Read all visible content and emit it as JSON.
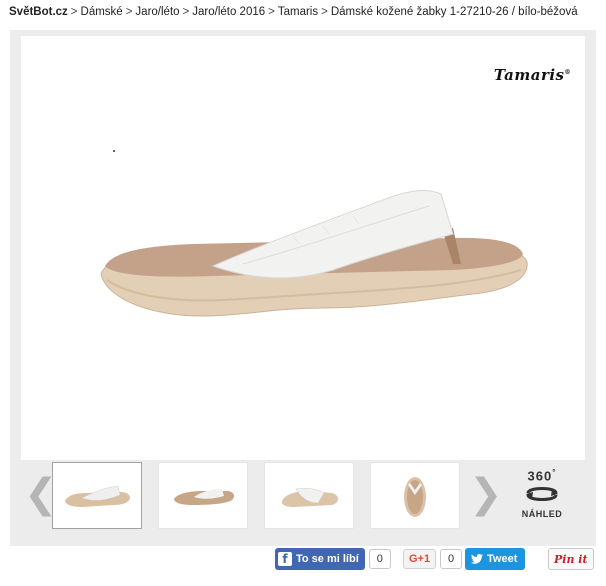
{
  "breadcrumb": {
    "items": [
      {
        "label": "SvětBot.cz"
      },
      {
        "label": "Dámské"
      },
      {
        "label": "Jaro/léto"
      },
      {
        "label": "Jaro/léto 2016"
      },
      {
        "label": "Tamaris"
      },
      {
        "label": "Dámské kožené žabky 1-27210-26 / bílo-béžová"
      }
    ],
    "separator": ">"
  },
  "gallery": {
    "brand_logo": "Tamaris",
    "brand_mark": "®",
    "prev_arrow": "❮",
    "next_arrow": "❯",
    "thumbnails": [
      {
        "icon": "sandal-side-view",
        "active": true
      },
      {
        "icon": "sandal-rear-angle",
        "active": false
      },
      {
        "icon": "sandal-front-angle",
        "active": false
      },
      {
        "icon": "sandal-top-view",
        "active": false
      }
    ],
    "view360": {
      "degrees": "360",
      "degree_symbol": "°",
      "label": "NÁHLED",
      "icon": "rotate-360-icon"
    }
  },
  "share": {
    "facebook": {
      "label": "To se mi líbí",
      "count": "0",
      "icon": "facebook-icon"
    },
    "gplus": {
      "label": "G+1",
      "count": "0",
      "icon": "google-plus-icon"
    },
    "twitter": {
      "label": "Tweet",
      "icon": "twitter-bird-icon"
    },
    "pinterest": {
      "label": "Pin it",
      "icon": "pinterest-icon"
    }
  },
  "colors": {
    "sole": "#e3cfb6",
    "footbed": "#c4a28a",
    "upper": "#f2f3f1",
    "facebook": "#4267b2",
    "twitter": "#1b95e0",
    "pinterest": "#cb2027",
    "frame": "#ececec"
  }
}
